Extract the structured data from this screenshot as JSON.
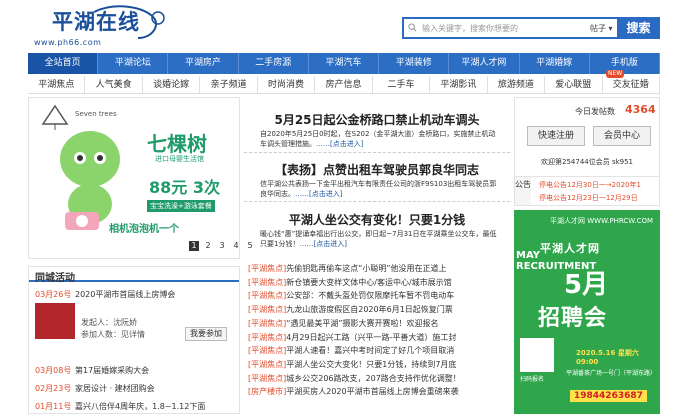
{
  "header": {
    "logo_text": "平湖在线",
    "logo_url": "www.ph66.com",
    "search_placeholder": "输入关键字，搜索你想要的",
    "search_category": "帖子",
    "search_button": "搜索"
  },
  "nav": [
    "全站首页",
    "平湖论坛",
    "平湖房产",
    "二手房源",
    "平湖汽车",
    "平湖装修",
    "平湖人才网",
    "平湖婚嫁",
    "手机版"
  ],
  "subnav": [
    "平湖焦点",
    "人气美食",
    "谈婚论嫁",
    "亲子频道",
    "时尚消费",
    "房产信息",
    "二手车",
    "平湖影讯",
    "旅游频道",
    "爱心联盟",
    "交友征婚"
  ],
  "new_tag": "NEW",
  "ad1": {
    "brand": "Seven trees",
    "title": "七棵树",
    "subtitle": "进口母婴生活馆",
    "price": "88元 3次",
    "tag": "宝宝洗澡+游泳套餐",
    "footer": "相机泡泡机一个"
  },
  "pager": [
    "1",
    "2",
    "3",
    "4",
    "5"
  ],
  "city": {
    "title": "同城活动",
    "rows": [
      {
        "date": "03月26号",
        "text": "2020平湖市首届线上房博会"
      },
      {
        "date": "03月08号",
        "text": "第17届婚嫁采购大会"
      },
      {
        "date": "02月23号",
        "text": "家居设计 · 建材团购会"
      },
      {
        "date": "01月11号",
        "text": "嘉兴八倍伴4周年庆，1.8~1.12下面"
      }
    ],
    "sponsor": "发起人：沈阮娇",
    "join": "参加人数：见详情",
    "join_btn": "我要参加"
  },
  "mid": {
    "h1": "5月25日起公金桥路口禁止机动车调头",
    "p1": "自2020年5月25日0时起，在S202（金平湖大道）金桥路口，实施禁止机动车调头管理措施。",
    "more": "……[点击进入]",
    "h2": "【表扬】点赞出租车驾驶员郭良华同志",
    "p2": "信平湖公共表扬一下金平出租汽车有限责任公司的浙F9S103出租车驾驶员郭良华同志。",
    "h3": "平湖人坐公交有变化！只要1分钱",
    "p3": "暖心钱“惠”提诵幸福出行出公交，即日起~7月31日在平湖乘坐公交车，最低只要1分钱！",
    "list": [
      [
        "[平湖焦点]",
        "先偷钥匙再偷车这点“小聪明”他没用在正道上"
      ],
      [
        "[平湖焦点]",
        "新仓镇要大变样文体中心/客运中心/城市展示馆"
      ],
      [
        "[平湖焦点]",
        "公安部：不戴头盔处罚仅限摩托车暂不罚电动车"
      ],
      [
        "[平湖焦点]",
        "九龙山旅游度假区自2020年6月1日起恢复门票"
      ],
      [
        "[平湖焦点]",
        "“遇见最美平湖”摄影大赛开赛啦！欢迎报名"
      ],
      [
        "[平湖焦点]",
        "4月29日起兴工路（兴平一路-平善大道）施工封"
      ],
      [
        "[平湖焦点]",
        "平湖人速看！嘉兴中考时间定了好几个项目取消"
      ],
      [
        "[平湖焦点]",
        "平湖人坐公交大变化！只要1分钱，持续到7月底"
      ],
      [
        "[平湖焦点]",
        "城乡公交206路改支，207路合支持作优化调整！"
      ],
      [
        "[房产楼市]",
        "平湖买房人2020平湖市首届线上房博会重磅来袭"
      ]
    ]
  },
  "right": {
    "today_label": "今日发帖数",
    "today_count": "4364",
    "register": "快速注册",
    "login": "会员中心",
    "welcome": "欢迎第254744位会员 sk951",
    "notice_label": "公告",
    "notices": [
      "停电公告12月30日一→2020年1",
      "停电公告12月23日一12月29日"
    ]
  },
  "rad": {
    "top": "平湖人才网 WWW.PHRCW.COM",
    "title1": "平湖人才网",
    "title2": "5月",
    "title3": "招聘会",
    "side": "MAY RECRUITMENT",
    "date": "2020.5.16 星期六 09:00",
    "addr": "平湖番茶广场一号门（平湖东路）",
    "phone": "19844263687",
    "qr_label": "扫码报名"
  }
}
